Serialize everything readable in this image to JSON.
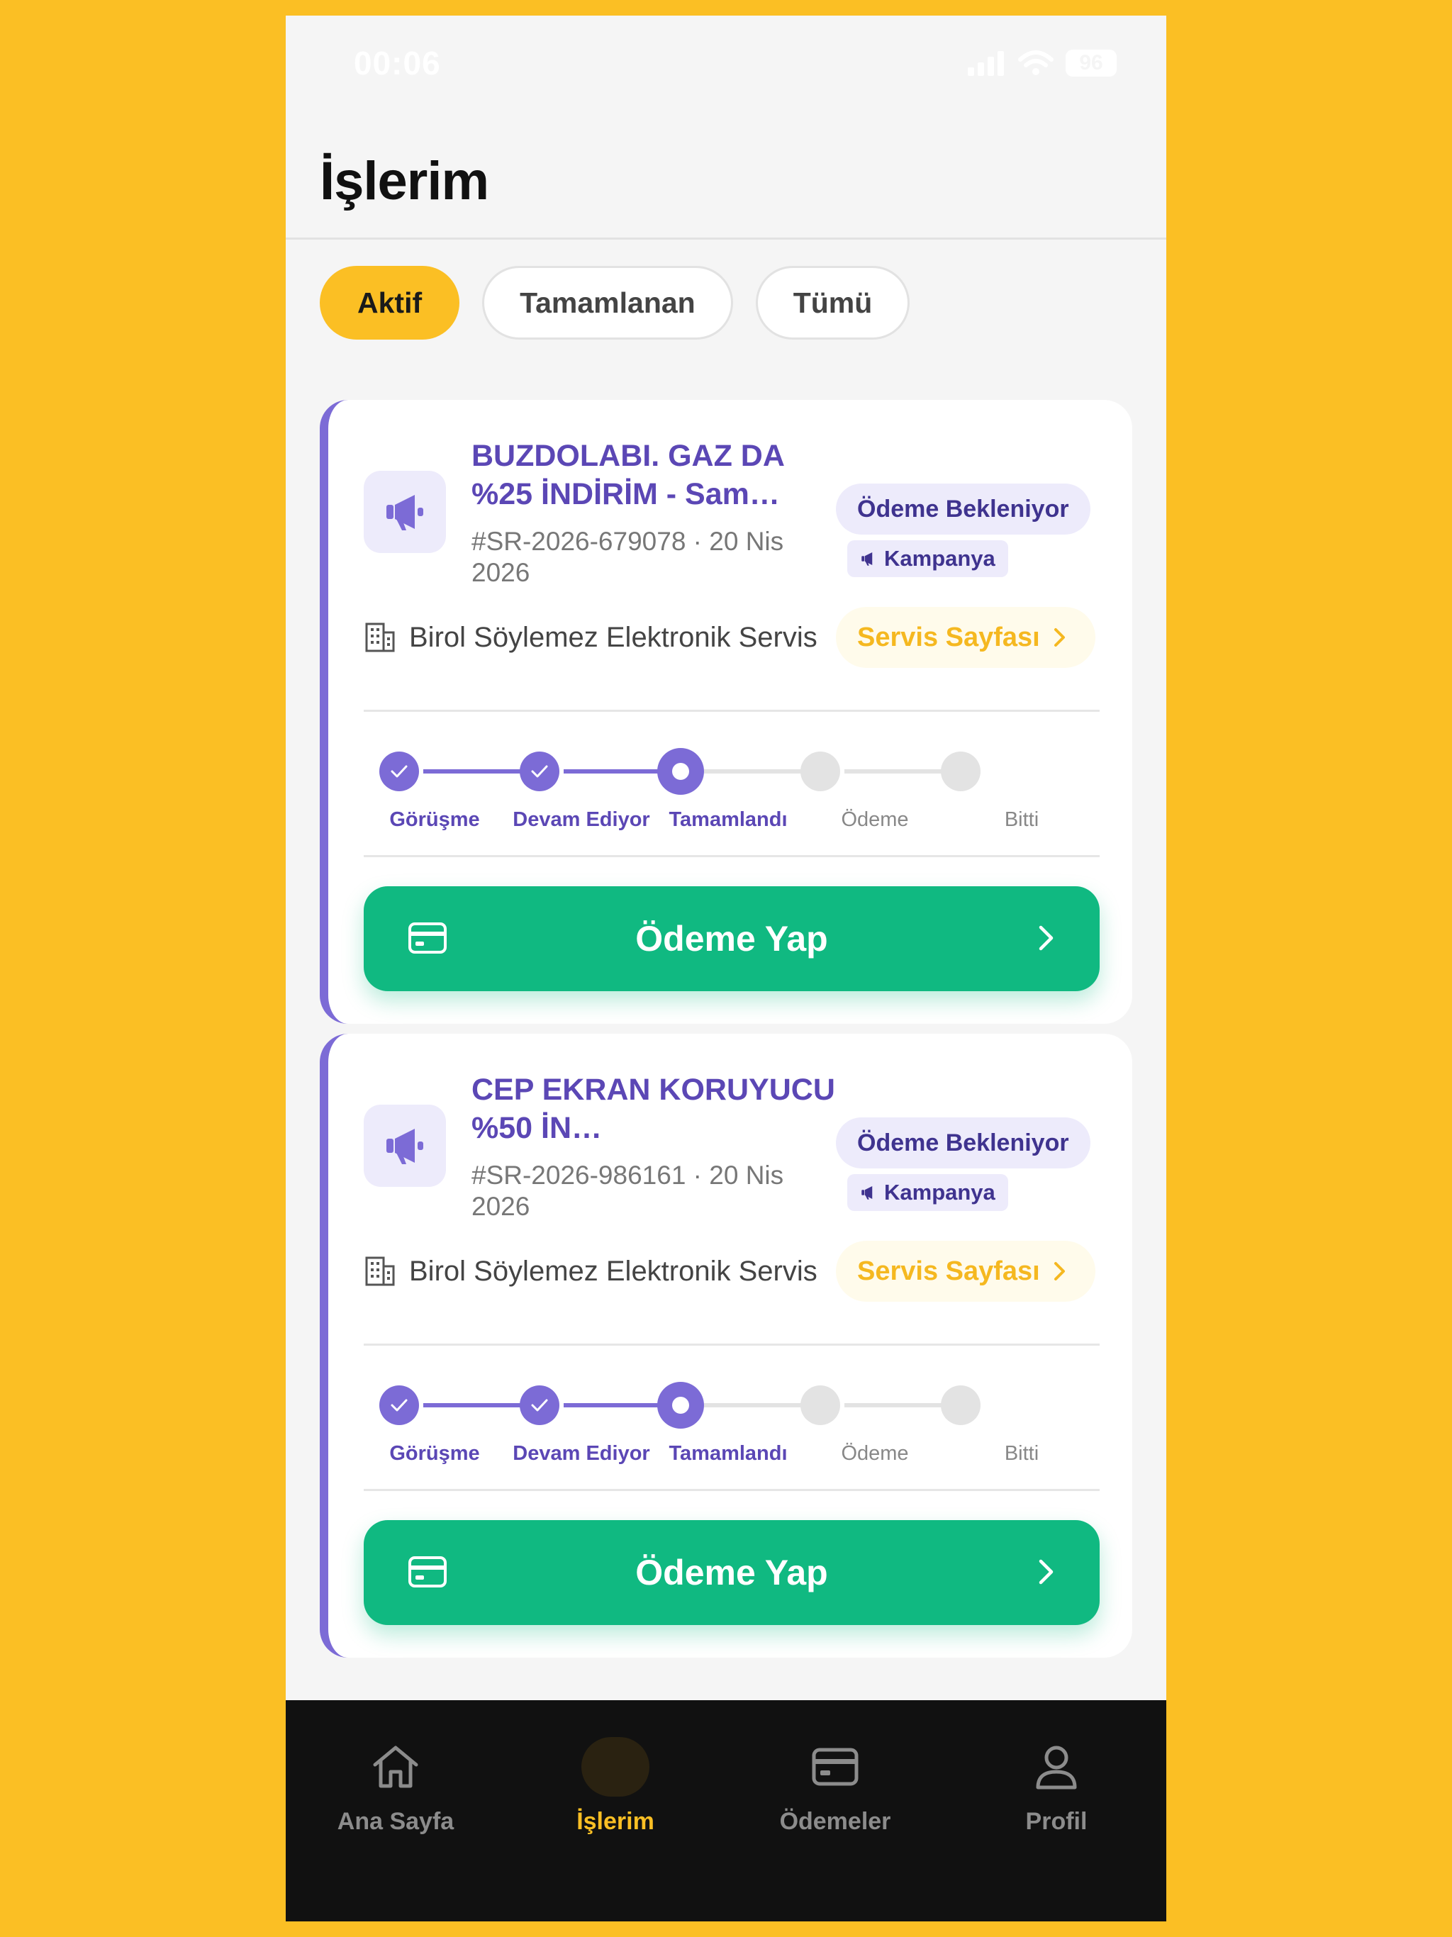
{
  "status_bar": {
    "time": "00:06",
    "battery": "96"
  },
  "page": {
    "title": "İşlerim"
  },
  "filters": [
    {
      "label": "Aktif",
      "active": true
    },
    {
      "label": "Tamamlanan",
      "active": false
    },
    {
      "label": "Tümü",
      "active": false
    }
  ],
  "jobs": [
    {
      "title": "BUZDOLABI. GAZ DA %25 İNDİRİM - Sam…",
      "meta": "#SR-2026-679078 · 20 Nis 2026",
      "status": "Ödeme Bekleniyor",
      "campaign": "Kampanya",
      "service_name": "Birol Söylemez Elektronik Servis",
      "service_link": "Servis Sayfası",
      "pay_label": "Ödeme Yap"
    },
    {
      "title": "CEP EKRAN KORUYUCU %50 İN…",
      "meta": "#SR-2026-986161 · 20 Nis 2026",
      "status": "Ödeme Bekleniyor",
      "campaign": "Kampanya",
      "service_name": "Birol Söylemez Elektronik Servis",
      "service_link": "Servis Sayfası",
      "pay_label": "Ödeme Yap"
    }
  ],
  "steps": [
    "Görüşme",
    "Devam Ediyor",
    "Tamamlandı",
    "Ödeme",
    "Bitti"
  ],
  "tabs": [
    {
      "label": "Ana Sayfa",
      "icon": "home-icon",
      "active": false
    },
    {
      "label": "İşlerim",
      "icon": "briefcase-icon",
      "active": true
    },
    {
      "label": "Ödemeler",
      "icon": "credit-card-icon",
      "active": false
    },
    {
      "label": "Profil",
      "icon": "user-icon",
      "active": false
    }
  ],
  "colors": {
    "background": "#FBBF24",
    "accent_purple": "#7C6BD6",
    "pay_green": "#10B981",
    "active_yellow": "#FBBF24",
    "tab_bar": "#111111"
  }
}
